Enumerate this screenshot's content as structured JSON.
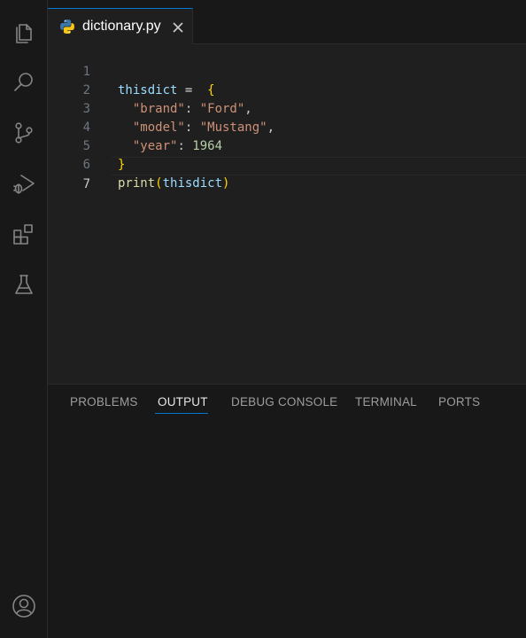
{
  "editor": {
    "tab": {
      "filename": "dictionary.py",
      "icon": "python-icon",
      "close_icon": "close-icon"
    },
    "lines": [
      {
        "number": "1",
        "text": "thisdict =  {"
      },
      {
        "number": "2",
        "text": "  \"brand\": \"Ford\","
      },
      {
        "number": "3",
        "text": "  \"model\": \"Mustang\","
      },
      {
        "number": "4",
        "text": "  \"year\": 1964"
      },
      {
        "number": "5",
        "text": "}"
      },
      {
        "number": "6",
        "text": "print(thisdict)"
      },
      {
        "number": "7",
        "text": ""
      }
    ],
    "active_line": "7"
  },
  "panel": {
    "tabs": [
      "PROBLEMS",
      "OUTPUT",
      "DEBUG CONSOLE",
      "TERMINAL",
      "PORTS"
    ],
    "active_tab": "OUTPUT"
  },
  "activity_bar": {
    "icons": [
      "files-icon",
      "search-icon",
      "source-control-icon",
      "run-debug-icon",
      "extensions-icon",
      "testing-icon"
    ],
    "bottom_icon": "account-icon"
  },
  "colors": {
    "accent": "#0078d4",
    "background": "#1f1f1f",
    "sidebar": "#181818"
  }
}
